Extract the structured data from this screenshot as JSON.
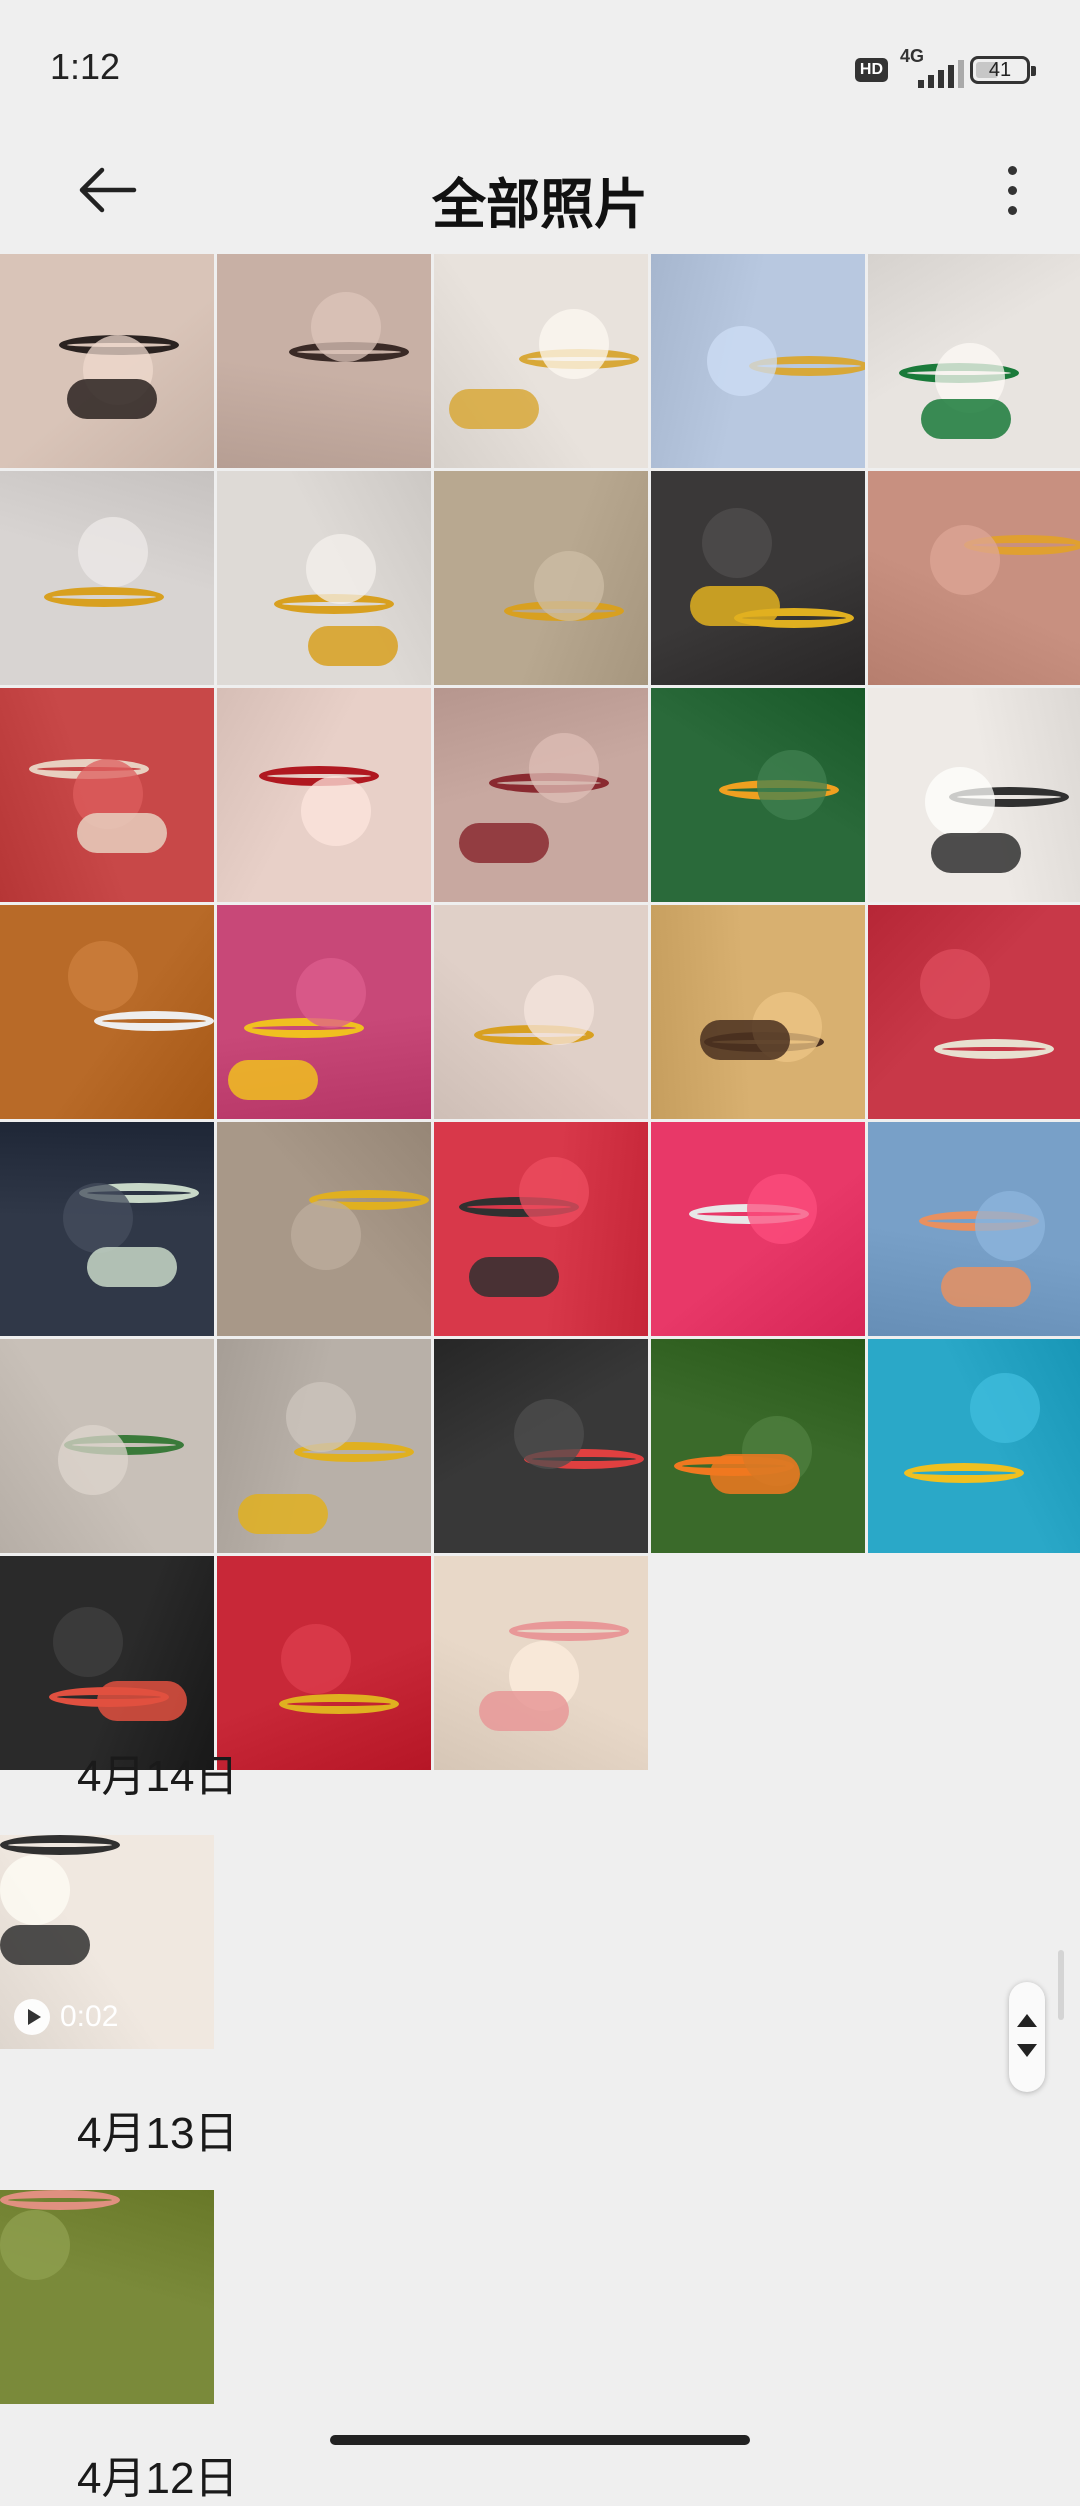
{
  "status_bar": {
    "time": "1:12",
    "hd": "HD",
    "network": "4G",
    "battery": "41"
  },
  "header": {
    "title": "全部照片",
    "back_icon": "arrow-left-icon",
    "more_icon": "more-vertical-icon"
  },
  "grid_photos": [
    {
      "desc": "selfie-bracelet",
      "bg": "#d9c4b8",
      "accent": "#2a2220"
    },
    {
      "desc": "selfie-bracelet-2",
      "bg": "#c8b0a5",
      "accent": "#3a2a26"
    },
    {
      "desc": "gold-bangles-fur",
      "bg": "#e8e2dc",
      "accent": "#d8a838"
    },
    {
      "desc": "gold-rings-hand",
      "bg": "#b8c8e0",
      "accent": "#d8a838"
    },
    {
      "desc": "nail-bracelet-green",
      "bg": "#e8e4e0",
      "accent": "#1a7a3a"
    },
    {
      "desc": "gold-bangle-wrist",
      "bg": "#d8d4d2",
      "accent": "#d8a020"
    },
    {
      "desc": "two-bangles-wrist",
      "bg": "#dedad6",
      "accent": "#d8a020"
    },
    {
      "desc": "gold-ring-finger",
      "bg": "#b8a890",
      "accent": "#d8a020"
    },
    {
      "desc": "gold-necklaces",
      "bg": "#3a3838",
      "accent": "#e0b020"
    },
    {
      "desc": "gold-bar-charms",
      "bg": "#c89080",
      "accent": "#e0a030"
    },
    {
      "desc": "jewelry-boxes-red",
      "bg": "#c84848",
      "accent": "#e8d0c0"
    },
    {
      "desc": "selfie-peace",
      "bg": "#e8d0c8",
      "accent": "#b01820"
    },
    {
      "desc": "selfie-bracelet-3",
      "bg": "#c8a8a0",
      "accent": "#8a2a30"
    },
    {
      "desc": "orange-handbag",
      "bg": "#2a6a3a",
      "accent": "#f0a020"
    },
    {
      "desc": "watch-box",
      "bg": "#eeeae6",
      "accent": "#303030"
    },
    {
      "desc": "watch-wood",
      "bg": "#b86a28",
      "accent": "#eeeeee"
    },
    {
      "desc": "gold-rings-pink",
      "bg": "#c84878",
      "accent": "#f0c020"
    },
    {
      "desc": "gold-jewelry-box",
      "bg": "#e0d0c8",
      "accent": "#d8a020"
    },
    {
      "desc": "lv-handbag",
      "bg": "#d8b070",
      "accent": "#4a3020"
    },
    {
      "desc": "jewelry-box-bag",
      "bg": "#c83848",
      "accent": "#e8e0d0"
    },
    {
      "desc": "car-bracelet",
      "bg": "#303848",
      "accent": "#c8d8c8"
    },
    {
      "desc": "jade-bracelet",
      "bg": "#a89888",
      "accent": "#e0b020"
    },
    {
      "desc": "car-key",
      "bg": "#d8384a",
      "accent": "#303030"
    },
    {
      "desc": "car-key-white",
      "bg": "#e83868",
      "accent": "#e8e8e8"
    },
    {
      "desc": "charms-palm",
      "bg": "#78a0c8",
      "accent": "#e89060"
    },
    {
      "desc": "beaded-bracelet",
      "bg": "#c8c0b8",
      "accent": "#3a7a3a"
    },
    {
      "desc": "gold-bangles-bag",
      "bg": "#b8b0a8",
      "accent": "#e0b020"
    },
    {
      "desc": "red-string-bracelet",
      "bg": "#383838",
      "accent": "#e04040"
    },
    {
      "desc": "oranges",
      "bg": "#3a6a2a",
      "accent": "#f07820"
    },
    {
      "desc": "gold-necklace-hand",
      "bg": "#2aa8c8",
      "accent": "#f0c020"
    },
    {
      "desc": "selfie-bracelets",
      "bg": "#2a2a2a",
      "accent": "#e05040"
    },
    {
      "desc": "gold-jewelry-display",
      "bg": "#c82838",
      "accent": "#e0b020"
    },
    {
      "desc": "cash-closet",
      "bg": "#e8d8c8",
      "accent": "#e89898"
    }
  ],
  "sections": [
    {
      "date": "4月14日",
      "items": [
        {
          "type": "video",
          "duration": "0:02",
          "bg": "#f0e8e0",
          "accent": "#303030"
        }
      ]
    },
    {
      "date": "4月13日",
      "items": [
        {
          "type": "photo",
          "bg": "#7a8a3a",
          "accent": "#e09080"
        }
      ]
    }
  ],
  "partial_date": "4月12日"
}
